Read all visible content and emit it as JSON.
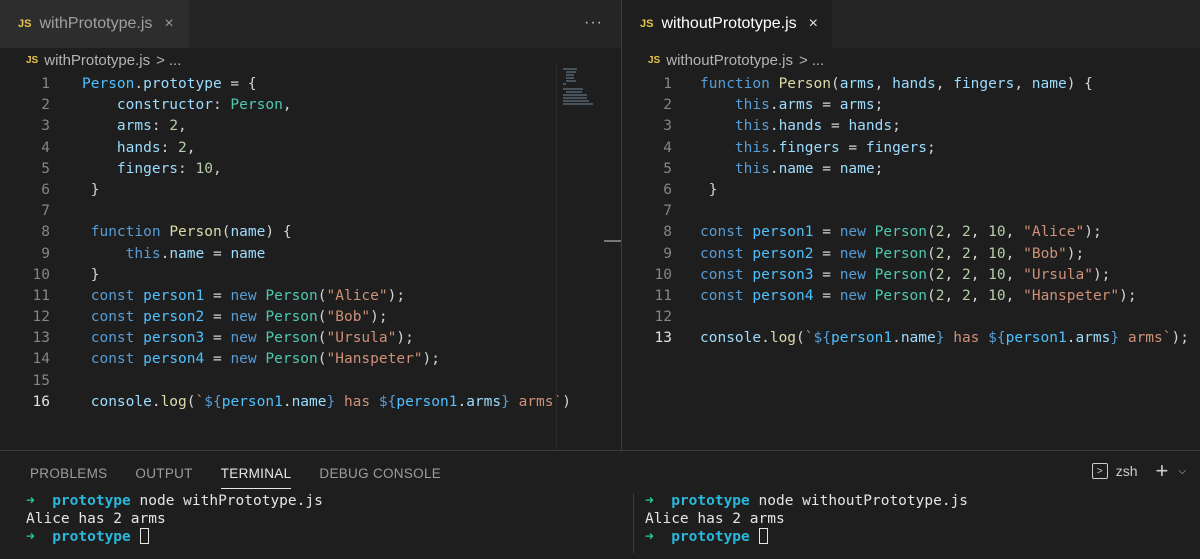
{
  "left_editor": {
    "tab": {
      "badge": "JS",
      "label": "withPrototype.js",
      "close": "×"
    },
    "more_actions": "···",
    "breadcrumb": {
      "badge": "JS",
      "file": "withPrototype.js",
      "sep": ">",
      "more": "..."
    },
    "current_line": 16,
    "lines": [
      {
        "n": "1",
        "t": [
          [
            "Person",
            "var"
          ],
          [
            ".",
            "op"
          ],
          [
            "prototype",
            "prop"
          ],
          [
            " = {",
            "op"
          ]
        ]
      },
      {
        "n": "2",
        "t": [
          [
            "    ",
            "op"
          ],
          [
            "constructor",
            "prop"
          ],
          [
            ": ",
            "op"
          ],
          [
            "Person",
            "fn"
          ],
          [
            ",",
            "op"
          ]
        ]
      },
      {
        "n": "3",
        "t": [
          [
            "    ",
            "op"
          ],
          [
            "arms",
            "prop"
          ],
          [
            ": ",
            "op"
          ],
          [
            "2",
            "num"
          ],
          [
            ",",
            "op"
          ]
        ]
      },
      {
        "n": "4",
        "t": [
          [
            "    ",
            "op"
          ],
          [
            "hands",
            "prop"
          ],
          [
            ": ",
            "op"
          ],
          [
            "2",
            "num"
          ],
          [
            ",",
            "op"
          ]
        ]
      },
      {
        "n": "5",
        "t": [
          [
            "    ",
            "op"
          ],
          [
            "fingers",
            "prop"
          ],
          [
            ": ",
            "op"
          ],
          [
            "10",
            "num"
          ],
          [
            ",",
            "op"
          ]
        ]
      },
      {
        "n": "6",
        "t": [
          [
            " }",
            "op"
          ]
        ]
      },
      {
        "n": "7",
        "t": []
      },
      {
        "n": "8",
        "t": [
          [
            " function",
            "kw"
          ],
          [
            " ",
            "op"
          ],
          [
            "Person",
            "fnc"
          ],
          [
            "(",
            "op"
          ],
          [
            "name",
            "prop"
          ],
          [
            ") {",
            "op"
          ]
        ]
      },
      {
        "n": "9",
        "t": [
          [
            "     ",
            "op"
          ],
          [
            "this",
            "kw"
          ],
          [
            ".",
            "op"
          ],
          [
            "name",
            "prop"
          ],
          [
            " = ",
            "op"
          ],
          [
            "name",
            "prop"
          ]
        ]
      },
      {
        "n": "10",
        "t": [
          [
            " }",
            "op"
          ]
        ]
      },
      {
        "n": "11",
        "t": [
          [
            " const",
            "kw"
          ],
          [
            " ",
            "op"
          ],
          [
            "person1",
            "var"
          ],
          [
            " = ",
            "op"
          ],
          [
            "new",
            "kw"
          ],
          [
            " ",
            "op"
          ],
          [
            "Person",
            "fn"
          ],
          [
            "(",
            "op"
          ],
          [
            "\"Alice\"",
            "str"
          ],
          [
            ");",
            "op"
          ]
        ]
      },
      {
        "n": "12",
        "t": [
          [
            " const",
            "kw"
          ],
          [
            " ",
            "op"
          ],
          [
            "person2",
            "var"
          ],
          [
            " = ",
            "op"
          ],
          [
            "new",
            "kw"
          ],
          [
            " ",
            "op"
          ],
          [
            "Person",
            "fn"
          ],
          [
            "(",
            "op"
          ],
          [
            "\"Bob\"",
            "str"
          ],
          [
            ");",
            "op"
          ]
        ]
      },
      {
        "n": "13",
        "t": [
          [
            " const",
            "kw"
          ],
          [
            " ",
            "op"
          ],
          [
            "person3",
            "var"
          ],
          [
            " = ",
            "op"
          ],
          [
            "new",
            "kw"
          ],
          [
            " ",
            "op"
          ],
          [
            "Person",
            "fn"
          ],
          [
            "(",
            "op"
          ],
          [
            "\"Ursula\"",
            "str"
          ],
          [
            ");",
            "op"
          ]
        ]
      },
      {
        "n": "14",
        "t": [
          [
            " const",
            "kw"
          ],
          [
            " ",
            "op"
          ],
          [
            "person4",
            "var"
          ],
          [
            " = ",
            "op"
          ],
          [
            "new",
            "kw"
          ],
          [
            " ",
            "op"
          ],
          [
            "Person",
            "fn"
          ],
          [
            "(",
            "op"
          ],
          [
            "\"Hanspeter\"",
            "str"
          ],
          [
            ");",
            "op"
          ]
        ]
      },
      {
        "n": "15",
        "t": []
      },
      {
        "n": "16",
        "t": [
          [
            " console",
            "prop"
          ],
          [
            ".",
            "op"
          ],
          [
            "log",
            "fnc"
          ],
          [
            "(",
            "op"
          ],
          [
            "`",
            "str"
          ],
          [
            "${",
            "kw"
          ],
          [
            "person1",
            "var"
          ],
          [
            ".",
            "op"
          ],
          [
            "name",
            "prop"
          ],
          [
            "}",
            "kw"
          ],
          [
            " has ",
            "str"
          ],
          [
            "${",
            "kw"
          ],
          [
            "person1",
            "var"
          ],
          [
            ".",
            "op"
          ],
          [
            "arms",
            "prop"
          ],
          [
            "}",
            "kw"
          ],
          [
            " arms`",
            "str"
          ],
          [
            ")",
            "op"
          ]
        ]
      }
    ]
  },
  "right_editor": {
    "tab": {
      "badge": "JS",
      "label": "withoutPrototype.js",
      "close": "×"
    },
    "breadcrumb": {
      "badge": "JS",
      "file": "withoutPrototype.js",
      "sep": ">",
      "more": "..."
    },
    "current_line": 13,
    "lines": [
      {
        "n": "1",
        "t": [
          [
            "function",
            "kw"
          ],
          [
            " ",
            "op"
          ],
          [
            "Person",
            "fnc"
          ],
          [
            "(",
            "op"
          ],
          [
            "arms",
            "prop"
          ],
          [
            ", ",
            "op"
          ],
          [
            "hands",
            "prop"
          ],
          [
            ", ",
            "op"
          ],
          [
            "fingers",
            "prop"
          ],
          [
            ", ",
            "op"
          ],
          [
            "name",
            "prop"
          ],
          [
            ") {",
            "op"
          ]
        ]
      },
      {
        "n": "2",
        "t": [
          [
            "    ",
            "op"
          ],
          [
            "this",
            "kw"
          ],
          [
            ".",
            "op"
          ],
          [
            "arms",
            "prop"
          ],
          [
            " = ",
            "op"
          ],
          [
            "arms",
            "prop"
          ],
          [
            ";",
            "op"
          ]
        ]
      },
      {
        "n": "3",
        "t": [
          [
            "    ",
            "op"
          ],
          [
            "this",
            "kw"
          ],
          [
            ".",
            "op"
          ],
          [
            "hands",
            "prop"
          ],
          [
            " = ",
            "op"
          ],
          [
            "hands",
            "prop"
          ],
          [
            ";",
            "op"
          ]
        ]
      },
      {
        "n": "4",
        "t": [
          [
            "    ",
            "op"
          ],
          [
            "this",
            "kw"
          ],
          [
            ".",
            "op"
          ],
          [
            "fingers",
            "prop"
          ],
          [
            " = ",
            "op"
          ],
          [
            "fingers",
            "prop"
          ],
          [
            ";",
            "op"
          ]
        ]
      },
      {
        "n": "5",
        "t": [
          [
            "    ",
            "op"
          ],
          [
            "this",
            "kw"
          ],
          [
            ".",
            "op"
          ],
          [
            "name",
            "prop"
          ],
          [
            " = ",
            "op"
          ],
          [
            "name",
            "prop"
          ],
          [
            ";",
            "op"
          ]
        ]
      },
      {
        "n": "6",
        "t": [
          [
            " }",
            "op"
          ]
        ]
      },
      {
        "n": "7",
        "t": []
      },
      {
        "n": "8",
        "t": [
          [
            "const",
            "kw"
          ],
          [
            " ",
            "op"
          ],
          [
            "person1",
            "var"
          ],
          [
            " = ",
            "op"
          ],
          [
            "new",
            "kw"
          ],
          [
            " ",
            "op"
          ],
          [
            "Person",
            "fn"
          ],
          [
            "(",
            "op"
          ],
          [
            "2",
            "num"
          ],
          [
            ", ",
            "op"
          ],
          [
            "2",
            "num"
          ],
          [
            ", ",
            "op"
          ],
          [
            "10",
            "num"
          ],
          [
            ", ",
            "op"
          ],
          [
            "\"Alice\"",
            "str"
          ],
          [
            ");",
            "op"
          ]
        ]
      },
      {
        "n": "9",
        "t": [
          [
            "const",
            "kw"
          ],
          [
            " ",
            "op"
          ],
          [
            "person2",
            "var"
          ],
          [
            " = ",
            "op"
          ],
          [
            "new",
            "kw"
          ],
          [
            " ",
            "op"
          ],
          [
            "Person",
            "fn"
          ],
          [
            "(",
            "op"
          ],
          [
            "2",
            "num"
          ],
          [
            ", ",
            "op"
          ],
          [
            "2",
            "num"
          ],
          [
            ", ",
            "op"
          ],
          [
            "10",
            "num"
          ],
          [
            ", ",
            "op"
          ],
          [
            "\"Bob\"",
            "str"
          ],
          [
            ");",
            "op"
          ]
        ]
      },
      {
        "n": "10",
        "t": [
          [
            "const",
            "kw"
          ],
          [
            " ",
            "op"
          ],
          [
            "person3",
            "var"
          ],
          [
            " = ",
            "op"
          ],
          [
            "new",
            "kw"
          ],
          [
            " ",
            "op"
          ],
          [
            "Person",
            "fn"
          ],
          [
            "(",
            "op"
          ],
          [
            "2",
            "num"
          ],
          [
            ", ",
            "op"
          ],
          [
            "2",
            "num"
          ],
          [
            ", ",
            "op"
          ],
          [
            "10",
            "num"
          ],
          [
            ", ",
            "op"
          ],
          [
            "\"Ursula\"",
            "str"
          ],
          [
            ");",
            "op"
          ]
        ]
      },
      {
        "n": "11",
        "t": [
          [
            "const",
            "kw"
          ],
          [
            " ",
            "op"
          ],
          [
            "person4",
            "var"
          ],
          [
            " = ",
            "op"
          ],
          [
            "new",
            "kw"
          ],
          [
            " ",
            "op"
          ],
          [
            "Person",
            "fn"
          ],
          [
            "(",
            "op"
          ],
          [
            "2",
            "num"
          ],
          [
            ", ",
            "op"
          ],
          [
            "2",
            "num"
          ],
          [
            ", ",
            "op"
          ],
          [
            "10",
            "num"
          ],
          [
            ", ",
            "op"
          ],
          [
            "\"Hanspeter\"",
            "str"
          ],
          [
            ");",
            "op"
          ]
        ]
      },
      {
        "n": "12",
        "t": []
      },
      {
        "n": "13",
        "t": [
          [
            "console",
            "prop"
          ],
          [
            ".",
            "op"
          ],
          [
            "log",
            "fnc"
          ],
          [
            "(",
            "op"
          ],
          [
            "`",
            "str"
          ],
          [
            "${",
            "kw"
          ],
          [
            "person1",
            "var"
          ],
          [
            ".",
            "op"
          ],
          [
            "name",
            "prop"
          ],
          [
            "}",
            "kw"
          ],
          [
            " has ",
            "str"
          ],
          [
            "${",
            "kw"
          ],
          [
            "person1",
            "var"
          ],
          [
            ".",
            "op"
          ],
          [
            "arms",
            "prop"
          ],
          [
            "}",
            "kw"
          ],
          [
            " arms`",
            "str"
          ],
          [
            ");",
            "op"
          ]
        ]
      }
    ]
  },
  "panel": {
    "tabs": [
      "PROBLEMS",
      "OUTPUT",
      "TERMINAL",
      "DEBUG CONSOLE"
    ],
    "active_tab": "TERMINAL",
    "shell_label": "zsh",
    "new_terminal": "+",
    "terminals": [
      {
        "lines": [
          {
            "arrow": "➜",
            "dir": "prototype",
            "cmd": " node withPrototype.js"
          },
          {
            "text": "Alice has 2 arms"
          },
          {
            "arrow": "➜",
            "dir": "prototype",
            "cmd": " ",
            "cursor": true
          }
        ]
      },
      {
        "lines": [
          {
            "arrow": "➜",
            "dir": "prototype",
            "cmd": " node withoutPrototype.js"
          },
          {
            "text": "Alice has 2 arms"
          },
          {
            "arrow": "➜",
            "dir": "prototype",
            "cmd": " ",
            "cursor": true
          }
        ]
      }
    ]
  },
  "colors": {
    "keyword": "#569cd6",
    "type": "#4ec9b0",
    "function": "#dcdcaa",
    "property": "#9cdcfe",
    "variable": "#4fc1ff",
    "string": "#ce9178",
    "number": "#b5cea8",
    "prompt_arrow": "#23d18b",
    "prompt_dir": "#29b8db"
  }
}
